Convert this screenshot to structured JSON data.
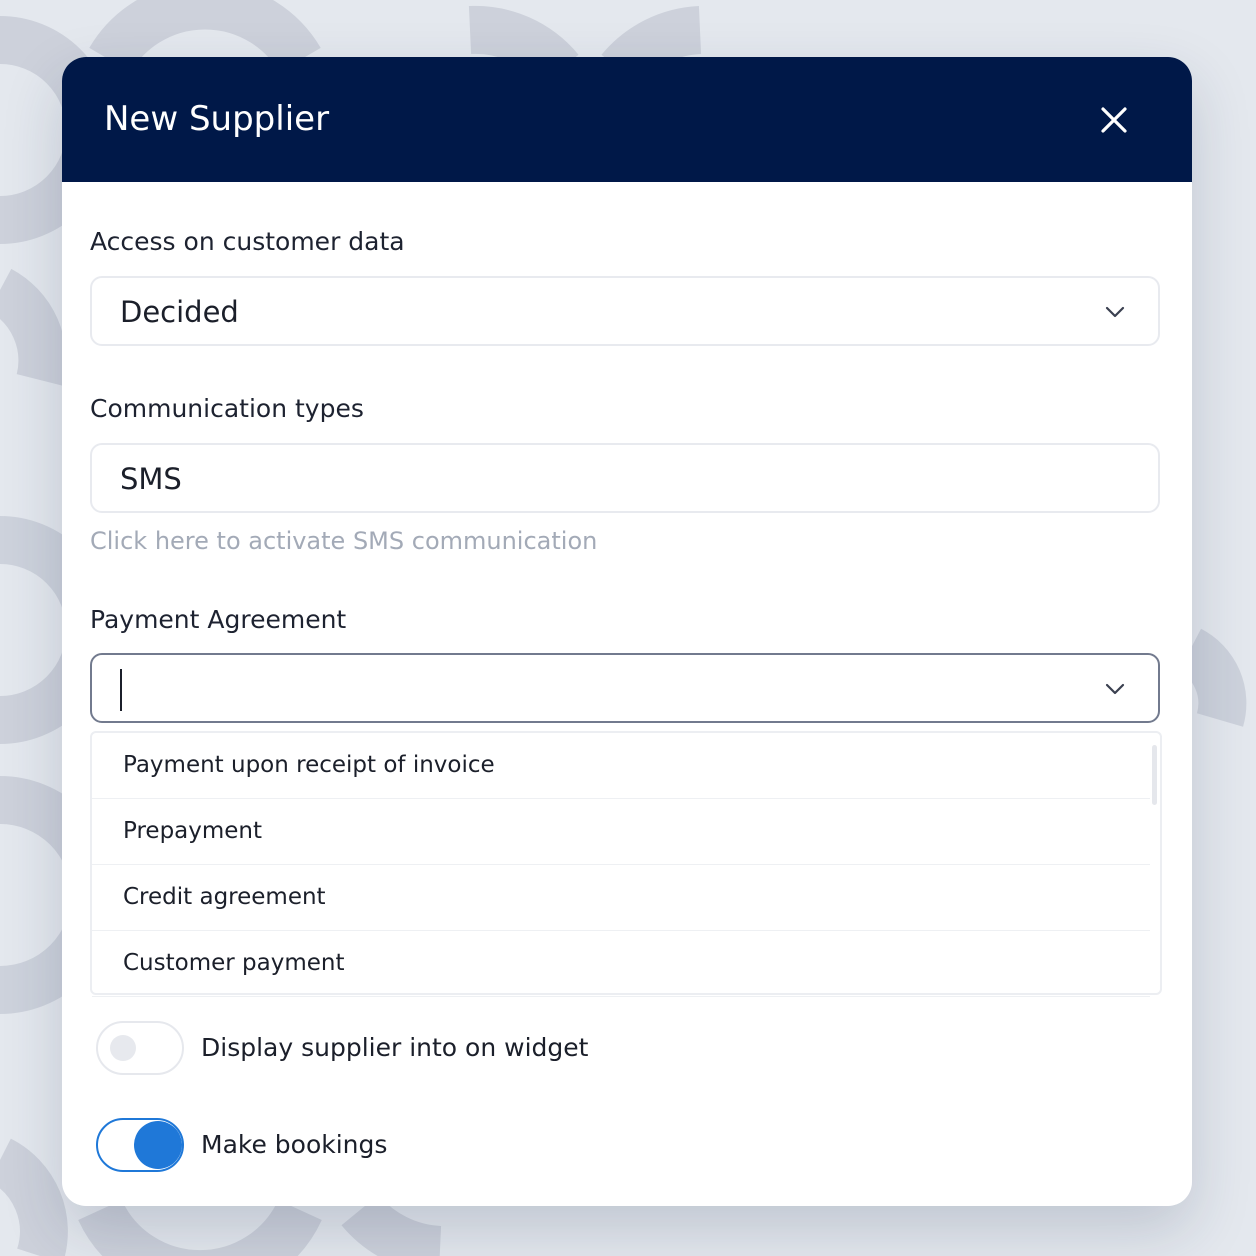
{
  "modal": {
    "title": "New Supplier",
    "close_icon": "close-icon"
  },
  "fields": {
    "access": {
      "label": "Access on customer data",
      "value": "Decided"
    },
    "communication": {
      "label": "Communication types",
      "value": "SMS",
      "hint": "Click here to activate SMS communication"
    },
    "payment": {
      "label": "Payment Agreement",
      "value": "",
      "options": [
        "Payment upon receipt of invoice",
        "Prepayment",
        "Credit agreement",
        "Customer payment"
      ]
    }
  },
  "toggles": {
    "widget": {
      "label": "Display supplier into on widget",
      "on": false
    },
    "bookings": {
      "label": "Make bookings",
      "on": true
    }
  },
  "colors": {
    "header": "#001848",
    "accent": "#1f78d8",
    "hint": "#a3aab7"
  }
}
